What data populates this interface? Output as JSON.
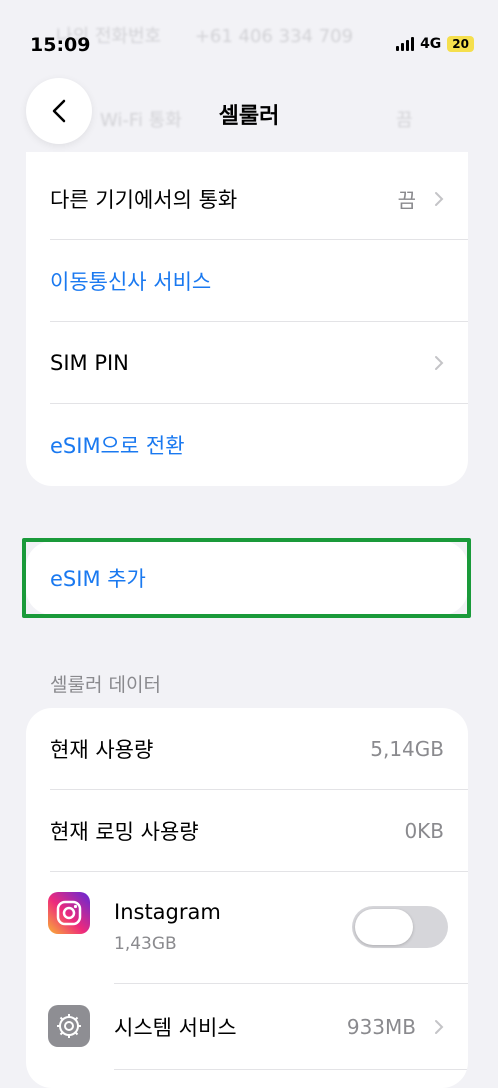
{
  "status_bar": {
    "time": "15:09",
    "network": "4G",
    "battery": "20"
  },
  "ghost_rows": [
    {
      "label": "나의 전화번호",
      "value": "+61 406 334 709"
    },
    {
      "label": "Wi-Fi 통화",
      "value": "끔"
    }
  ],
  "nav": {
    "title": "셀룰러",
    "back_icon": "chevron-left-icon"
  },
  "group1": {
    "rows": [
      {
        "label": "다른 기기에서의 통화",
        "value": "끔"
      },
      {
        "label": "이동통신사 서비스"
      },
      {
        "label": "SIM PIN"
      },
      {
        "label": "eSIM으로 전환"
      }
    ]
  },
  "esim_add": {
    "label": "eSIM 추가"
  },
  "data_section": {
    "header": "셀룰러 데이터",
    "current_usage": {
      "label": "현재 사용량",
      "value": "5,14GB"
    },
    "roaming_usage": {
      "label": "현재 로밍 사용량",
      "value": "0KB"
    },
    "apps": [
      {
        "name": "Instagram",
        "usage": "1,43GB",
        "icon": "instagram-icon",
        "enabled": false
      },
      {
        "name": "시스템 서비스",
        "usage": "933MB",
        "icon": "gear-icon"
      }
    ]
  },
  "colors": {
    "accent": "#1a79f0",
    "highlight": "#1a9a3a",
    "background": "#f2f2f6"
  }
}
